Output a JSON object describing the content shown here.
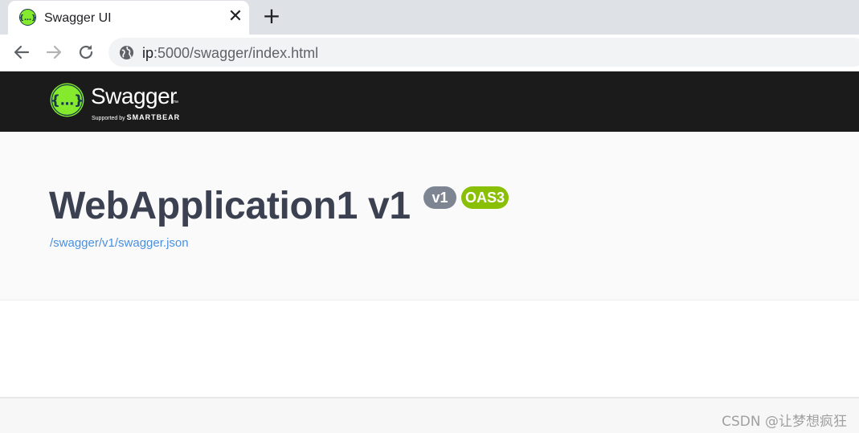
{
  "browser": {
    "tab": {
      "title": "Swagger UI",
      "favicon": "swagger-icon",
      "close_glyph": "✕"
    },
    "new_tab_glyph": "+",
    "toolbar": {
      "back": "arrow-left-icon",
      "forward": "arrow-right-icon",
      "reload": "reload-icon"
    },
    "address": {
      "host": "ip",
      "path": ":5000/swagger/index.html",
      "site_icon": "globe-icon"
    }
  },
  "topbar": {
    "logo_name": "Swagger",
    "logo_tm": "™",
    "supported_by": "Supported by",
    "brand": "SMARTBEAR",
    "logo_glyph": "{…}"
  },
  "info": {
    "title": "WebApplication1 v1",
    "version_badge": "v1",
    "oas_badge": "OAS3",
    "spec_url": "/swagger/v1/swagger.json"
  },
  "watermark": "CSDN @让梦想疯狂",
  "colors": {
    "topbar_bg": "#1b1b1b",
    "brand_green": "#85ea2d",
    "title": "#3b4151",
    "version_badge": "#7d8492",
    "oas_badge": "#89bf04",
    "link": "#4990e2"
  }
}
